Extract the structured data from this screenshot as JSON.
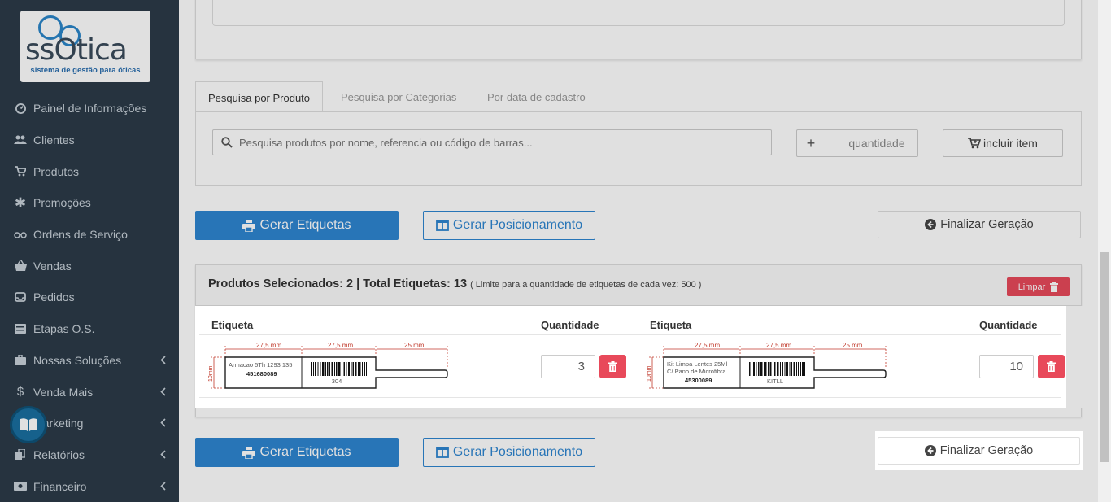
{
  "sidebar": {
    "logo": {
      "word": "ssOtica",
      "tagline": "sistema de gestão para óticas"
    },
    "items": [
      {
        "label": "Painel de Informações",
        "icon": "dashboard-icon",
        "chevron": false
      },
      {
        "label": "Clientes",
        "icon": "users-icon",
        "chevron": false
      },
      {
        "label": "Produtos",
        "icon": "cart-icon",
        "chevron": false
      },
      {
        "label": "Promoções",
        "icon": "asterisk-icon",
        "chevron": false
      },
      {
        "label": "Ordens de Serviço",
        "icon": "glasses-icon",
        "chevron": false
      },
      {
        "label": "Vendas",
        "icon": "basket-icon",
        "chevron": false
      },
      {
        "label": "Pedidos",
        "icon": "inbox-icon",
        "chevron": false
      },
      {
        "label": "Etapas O.S.",
        "icon": "tasks-icon",
        "chevron": false
      },
      {
        "label": "Nossas Soluções",
        "icon": "briefcase-icon",
        "chevron": true
      },
      {
        "label": "Venda Mais",
        "icon": "dollar-icon",
        "chevron": true
      },
      {
        "label": "Marketing",
        "icon": "megaphone-icon",
        "chevron": true
      },
      {
        "label": "Relatórios",
        "icon": "copy-icon",
        "chevron": true
      },
      {
        "label": "Financeiro",
        "icon": "money-icon",
        "chevron": true
      }
    ]
  },
  "tabs": [
    {
      "label": "Pesquisa por Produto",
      "active": true
    },
    {
      "label": "Pesquisa por Categorias",
      "active": false
    },
    {
      "label": "Por data de cadastro",
      "active": false
    }
  ],
  "search": {
    "placeholder": "Pesquisa produtos por nome, referencia ou código de barras..."
  },
  "quantity": {
    "plus": "+",
    "placeholder": "quantidade"
  },
  "include_button": "incluir item",
  "actions": {
    "generate_labels": "Gerar Etiquetas",
    "generate_positioning": "Gerar Posicionamento",
    "finalize": "Finalizar Geração"
  },
  "selected": {
    "title": "Produtos Selecionados: 2 | Total Etiquetas: 13",
    "limit_note": "( Limite para a quantidade de etiquetas de cada vez: 500 )",
    "clear_button": "Limpar",
    "columns": {
      "label": "Etiqueta",
      "quantity": "Quantidade"
    },
    "items": [
      {
        "name": "Armacao 5Th 1293 135",
        "name2": "",
        "code": "451680089",
        "barcode_text": "304",
        "quantity": "3"
      },
      {
        "name": "Kit Limpa Lentes 25Ml",
        "name2": "C/ Pano de Microfibra",
        "code": "45300089",
        "barcode_text": "KITLL",
        "quantity": "10"
      }
    ],
    "dims": {
      "a": "27,5 mm",
      "b": "27,5 mm",
      "c": "25 mm",
      "h": "10mm"
    }
  },
  "colors": {
    "primary": "#2e86d1",
    "danger": "#e8495a",
    "sidebar": "#2c3b48"
  }
}
